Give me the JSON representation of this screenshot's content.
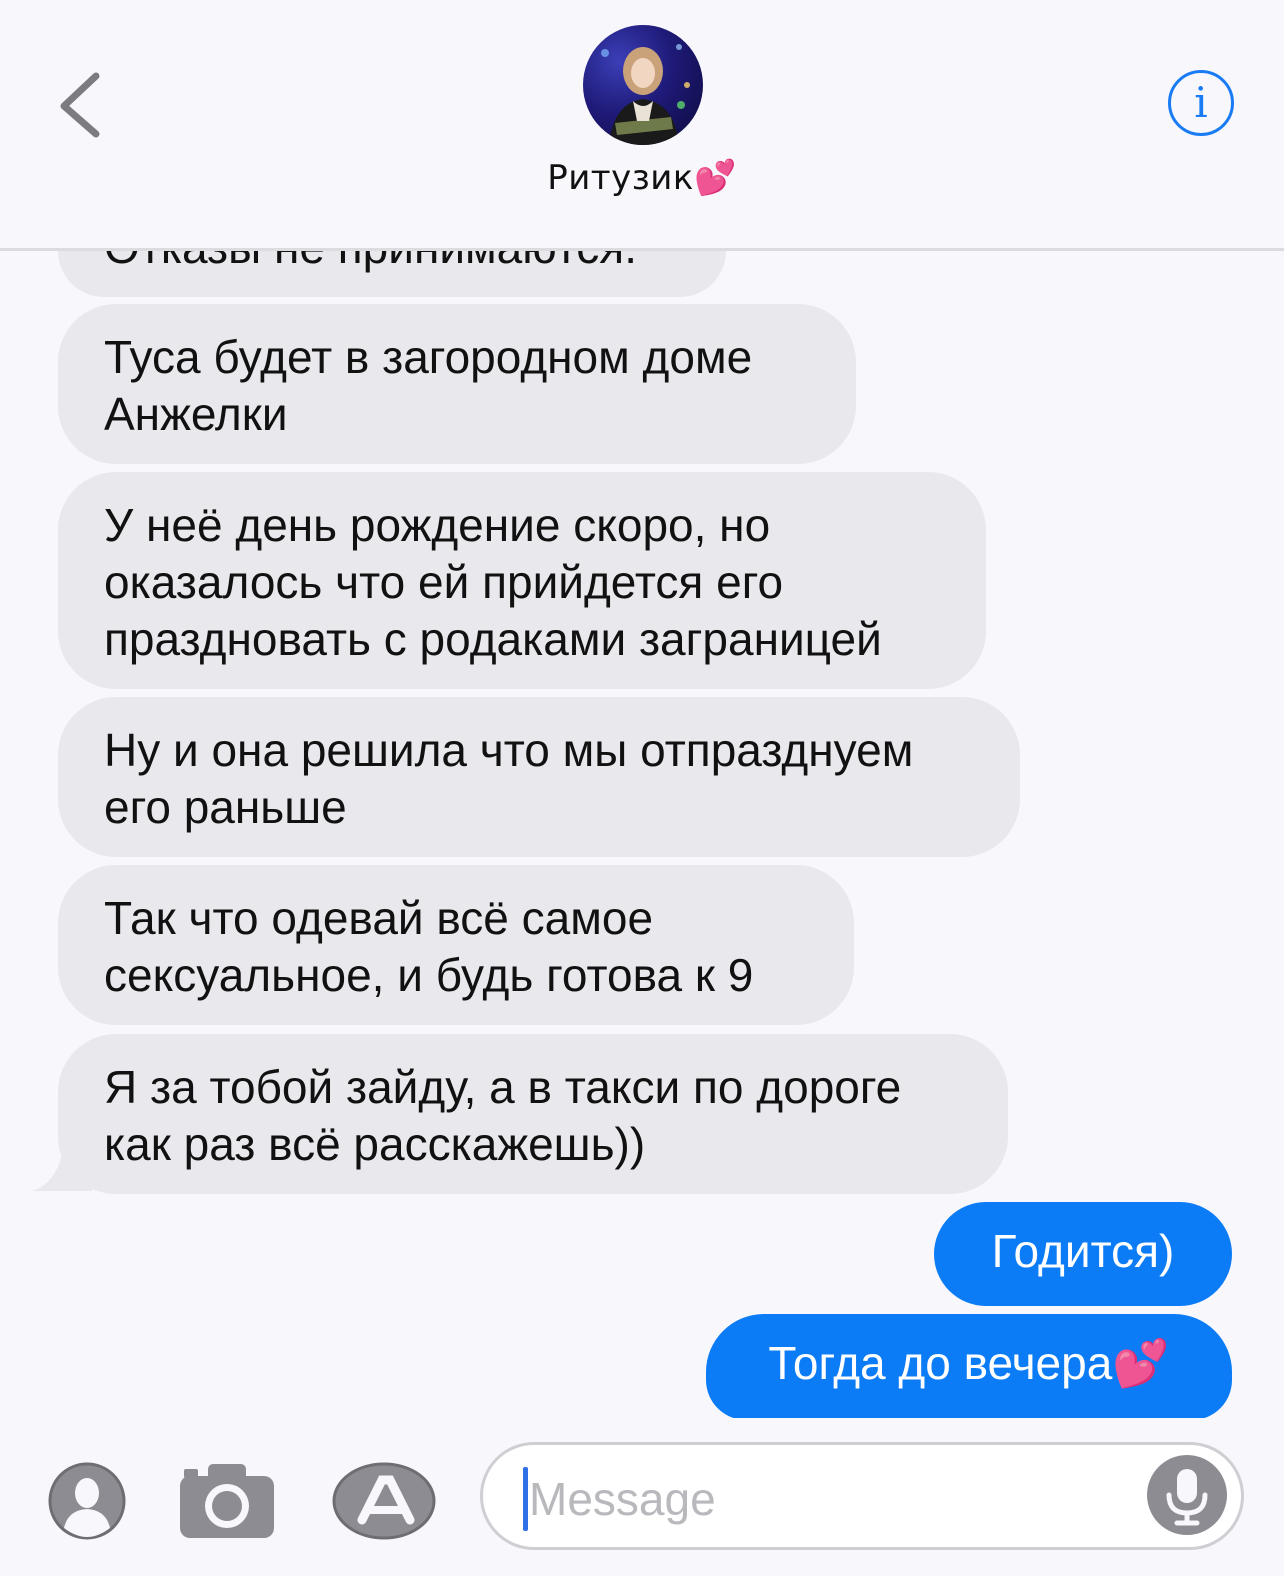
{
  "header": {
    "contact_name": "Ритузик💕",
    "back": "chevron-left-icon",
    "info": "i"
  },
  "messages": {
    "partial_top": "Отказы не принимаются.",
    "incoming": [
      "Туса будет в загородном доме Анжелки",
      "У неё день рождение скоро, но оказалось что ей прийдется его праздновать с родаками заграницей",
      "Ну и она решила что мы отпразднуем его раньше",
      "Так что одевай всё самое сексуальное, и будь готова к 9",
      "Я за тобой зайду, а в такси по дороге как раз всё расскажешь))"
    ],
    "outgoing": [
      "Годится)",
      "Тогда до вечера💕"
    ]
  },
  "input": {
    "placeholder": "Message",
    "icons": [
      "contact-icon",
      "camera-icon",
      "app-store-icon",
      "microphone-icon"
    ]
  },
  "colors": {
    "incoming_bubble": "#e9e8ed",
    "outgoing_bubble": "#0b7cf5",
    "accent": "#1a7cf5",
    "background": "#f8f7fb"
  }
}
